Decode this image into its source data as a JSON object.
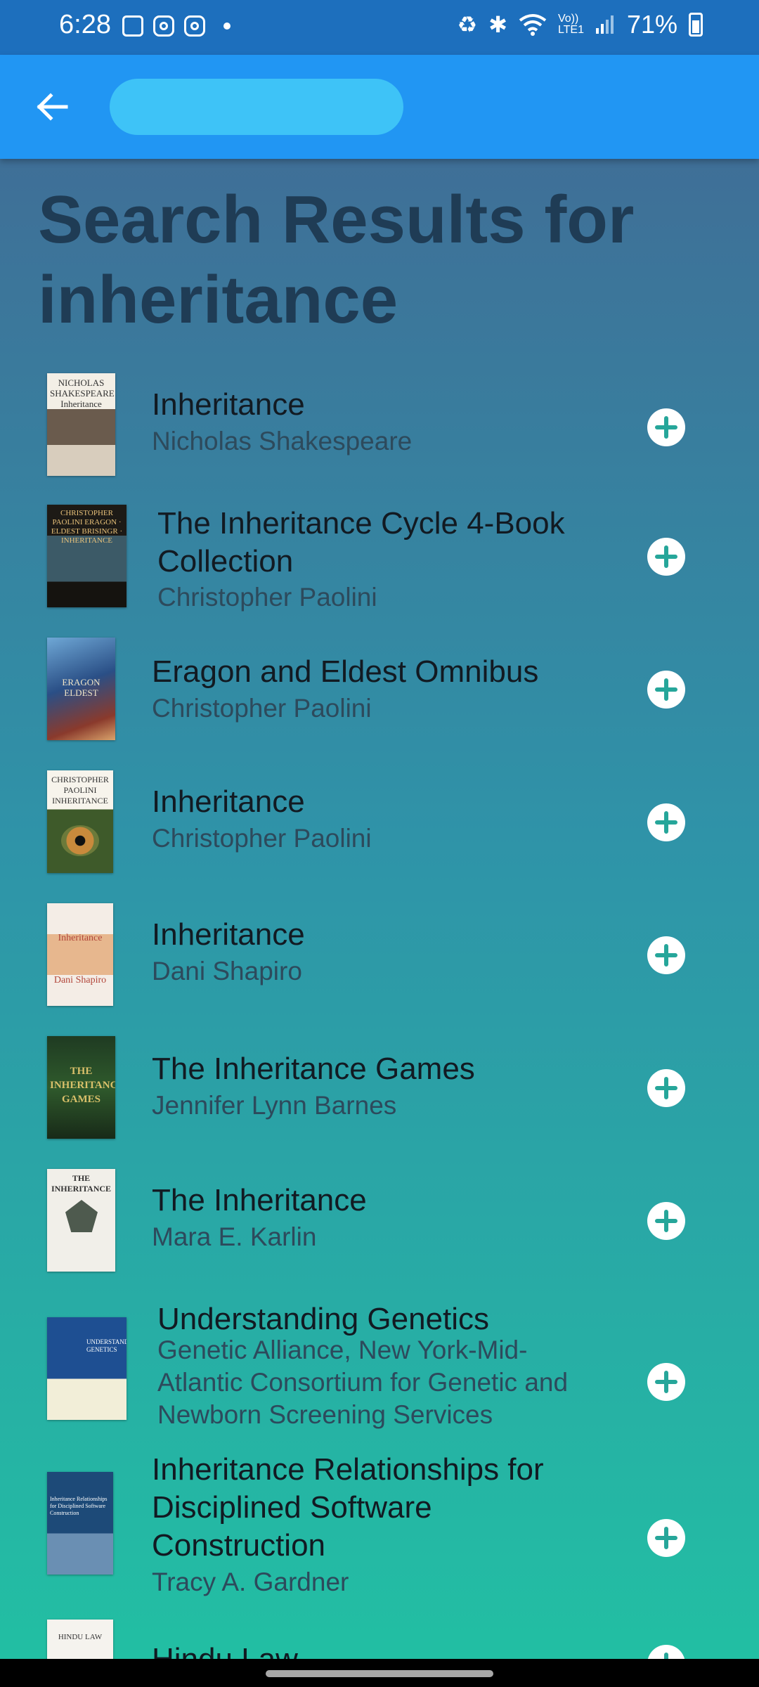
{
  "status_bar": {
    "time": "6:28",
    "network": "Vo)) LTE1",
    "battery": "71%"
  },
  "header": {
    "title_redacted": true
  },
  "page": {
    "title": "Search Results for inheritance"
  },
  "results": [
    {
      "title": "Inheritance",
      "author": "Nicholas Shakespeare",
      "cover_text": "NICHOLAS SHAKESPEARE Inheritance"
    },
    {
      "title": "The Inheritance Cycle 4-Book Collection",
      "author": "Christopher Paolini",
      "cover_text": "CHRISTOPHER PAOLINI ERAGON · ELDEST BRISINGR · INHERITANCE"
    },
    {
      "title": "Eragon and Eldest Omnibus",
      "author": "Christopher Paolini",
      "cover_text": "ERAGON ELDEST"
    },
    {
      "title": "Inheritance",
      "author": "Christopher Paolini",
      "cover_text": "CHRISTOPHER PAOLINI INHERITANCE"
    },
    {
      "title": "Inheritance",
      "author": "Dani Shapiro",
      "cover_text": "Inheritance Dani Shapiro"
    },
    {
      "title": "The Inheritance Games",
      "author": "Jennifer Lynn Barnes",
      "cover_text": "THE INHERITANCE GAMES"
    },
    {
      "title": "The Inheritance",
      "author": "Mara E. Karlin",
      "cover_text": "THE INHERITANCE"
    },
    {
      "title": "Understanding Genetics",
      "author": "Genetic Alliance, New York-Mid-Atlantic Consortium for Genetic and Newborn Screening Services",
      "cover_text": "UNDERSTANDING GENETICS"
    },
    {
      "title": "Inheritance Relationships for Disciplined Software Construction",
      "author": "Tracy A. Gardner",
      "cover_text": "Inheritance Relationships for Disciplined Software Construction"
    },
    {
      "title": "Hindu Law",
      "author": "",
      "cover_text": "HINDU LAW"
    }
  ],
  "colors": {
    "status_bar": "#1d6fbd",
    "app_bar": "#2196f3",
    "add_icon": "#26a69a"
  }
}
